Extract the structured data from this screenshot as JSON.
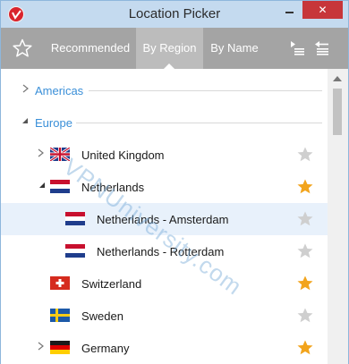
{
  "window": {
    "title": "Location Picker",
    "controls": {
      "minimize": "minimize",
      "maximize": "maximize",
      "close": "✕"
    }
  },
  "toolbar": {
    "tabs": [
      {
        "label": "Recommended",
        "active": false
      },
      {
        "label": "By Region",
        "active": true
      },
      {
        "label": "By Name",
        "active": false
      }
    ]
  },
  "groups": [
    {
      "label": "Americas",
      "expanded": false
    },
    {
      "label": "Europe",
      "expanded": true
    }
  ],
  "locations": [
    {
      "name": "United Kingdom",
      "flag": "uk-flag-icon",
      "expandable": true,
      "expanded": false,
      "favorite": false,
      "level": 1
    },
    {
      "name": "Netherlands",
      "flag": "netherlands-flag-icon",
      "expandable": true,
      "expanded": true,
      "favorite": true,
      "level": 1
    },
    {
      "name": "Netherlands - Amsterdam",
      "flag": "netherlands-flag-icon",
      "expandable": false,
      "favorite": false,
      "level": 2,
      "selected": true
    },
    {
      "name": "Netherlands - Rotterdam",
      "flag": "netherlands-flag-icon",
      "expandable": false,
      "favorite": false,
      "level": 2
    },
    {
      "name": "Switzerland",
      "flag": "switzerland-flag-icon",
      "expandable": false,
      "favorite": true,
      "level": 1
    },
    {
      "name": "Sweden",
      "flag": "sweden-flag-icon",
      "expandable": false,
      "favorite": false,
      "level": 1
    },
    {
      "name": "Germany",
      "flag": "germany-flag-icon",
      "expandable": true,
      "expanded": false,
      "favorite": true,
      "level": 1
    }
  ],
  "watermark": "VPNUniversity.com",
  "colors": {
    "titlebar": "#c4daef",
    "toolbar": "#a4a4a4",
    "active_tab": "#bcbcbc",
    "group_label": "#3a8fd8",
    "favorite_star": "#f2a41c",
    "unfavorite_star": "#cfcfcf",
    "selected_row": "#e8f1fb"
  }
}
